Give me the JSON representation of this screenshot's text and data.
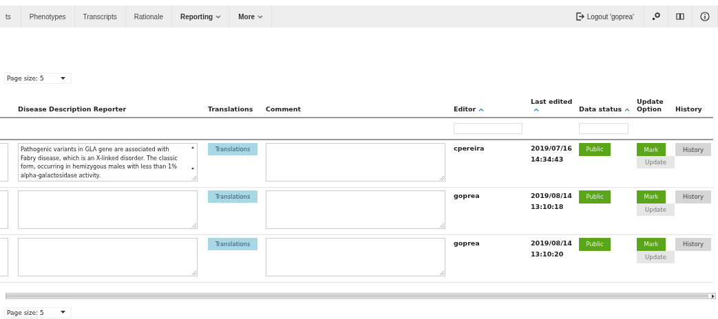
{
  "nav": {
    "items": [
      {
        "label": "ts",
        "kind": "link"
      },
      {
        "label": "Phenotypes",
        "kind": "link"
      },
      {
        "label": "Transcripts",
        "kind": "link"
      },
      {
        "label": "Rationale",
        "kind": "link"
      },
      {
        "label": "Reporting",
        "kind": "menu"
      },
      {
        "label": "More",
        "kind": "menu"
      }
    ],
    "logout": "Logout 'goprea'"
  },
  "page_size_top": "Page size: 5",
  "table": {
    "columns": [
      {
        "label": "Disease Description Reporter",
        "sortable": false
      },
      {
        "label": "Translations",
        "sortable": false
      },
      {
        "label": "Comment",
        "sortable": false
      },
      {
        "label": "Editor",
        "sortable": true
      },
      {
        "label": "Last edited",
        "sortable": true
      },
      {
        "label": "Data status",
        "sortable": true
      },
      {
        "label": "Update Option",
        "sortable": false
      },
      {
        "label": "History",
        "sortable": false
      }
    ],
    "filter_row": [
      {
        "kind": "blank"
      },
      {
        "kind": "blank"
      },
      {
        "kind": "blank"
      },
      {
        "kind": "input"
      },
      {
        "kind": "blank"
      },
      {
        "kind": "input"
      },
      {
        "kind": "blank"
      },
      {
        "kind": "blank"
      }
    ],
    "rows": [
      {
        "description": "Pathogenic variants in GLA gene are associated with Fabry disease, which is an X-linked disorder. The classic form, occurring in hemizygous males with less than 1% alpha-galactosidase activity.",
        "translations": "Translations",
        "editor": "cpereira",
        "last_edited": "2019/07/16 14:34:43",
        "status": "Public",
        "mark": "Mark",
        "update": "Update",
        "update_disabled": true,
        "history": "History"
      },
      {
        "translations": "Translations",
        "editor": "goprea",
        "last_edited": "2019/08/14 13:10:18",
        "status": "Public",
        "mark": "Mark",
        "update": "Update",
        "update_disabled": true,
        "history": "History"
      },
      {
        "translations": "Translations",
        "editor": "goprea",
        "last_edited": "2019/08/14 13:10:20",
        "status": "Public",
        "mark": "Mark",
        "update": "Update",
        "update_disabled": true,
        "history": "History"
      }
    ]
  },
  "page_size_bottom": "Page size: 5"
}
